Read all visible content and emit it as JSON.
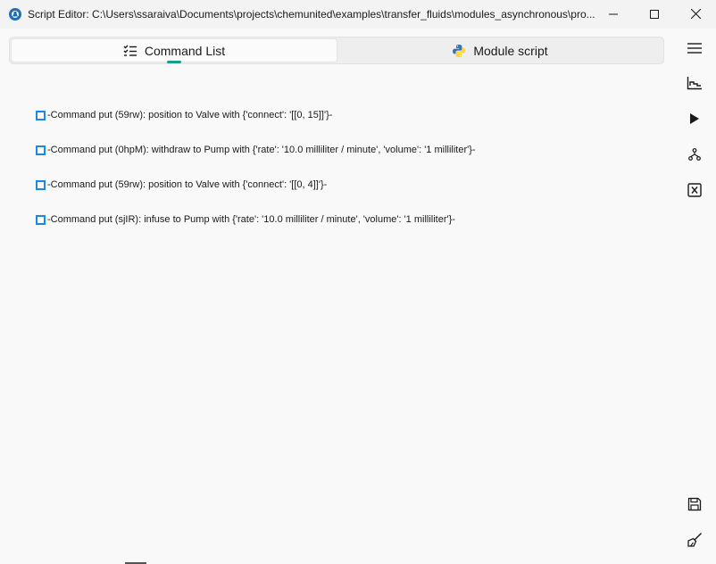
{
  "window": {
    "title": "Script Editor: C:\\Users\\ssaraiva\\Documents\\projects\\chemunited\\examples\\transfer_fluids\\modules_asynchronous\\pro...",
    "app_icon": "flask-gear-icon",
    "controls": [
      "minimize-icon",
      "maximize-icon",
      "close-icon"
    ]
  },
  "tabs": [
    {
      "label": "Command List",
      "icon": "checklist-icon",
      "active": true
    },
    {
      "label": "Module script",
      "icon": "python-icon",
      "active": false
    }
  ],
  "commands": [
    {
      "text": "-Command put (59rw): position to Valve with {'connect': '[[0, 15]]'}-"
    },
    {
      "text": "-Command put (0hpM): withdraw to Pump with {'rate': '10.0 milliliter / minute', 'volume': '1 milliliter'}-"
    },
    {
      "text": "-Command put (59rw): position to Valve with {'connect': '[[0, 4]]'}-"
    },
    {
      "text": "-Command put (sjIR): infuse to Pump with {'rate': '10.0 milliliter / minute', 'volume': '1 milliliter'}-"
    }
  ],
  "toolbar": {
    "items": [
      "hamburger-menu-icon",
      "chart-icon",
      "play-icon",
      "hierarchy-icon",
      "variable-x-icon",
      "save-icon",
      "broom-icon"
    ]
  },
  "colors": {
    "accent": "#1b9c8a",
    "checkbox": "#1e88e5",
    "background": "#f9f9f9"
  }
}
